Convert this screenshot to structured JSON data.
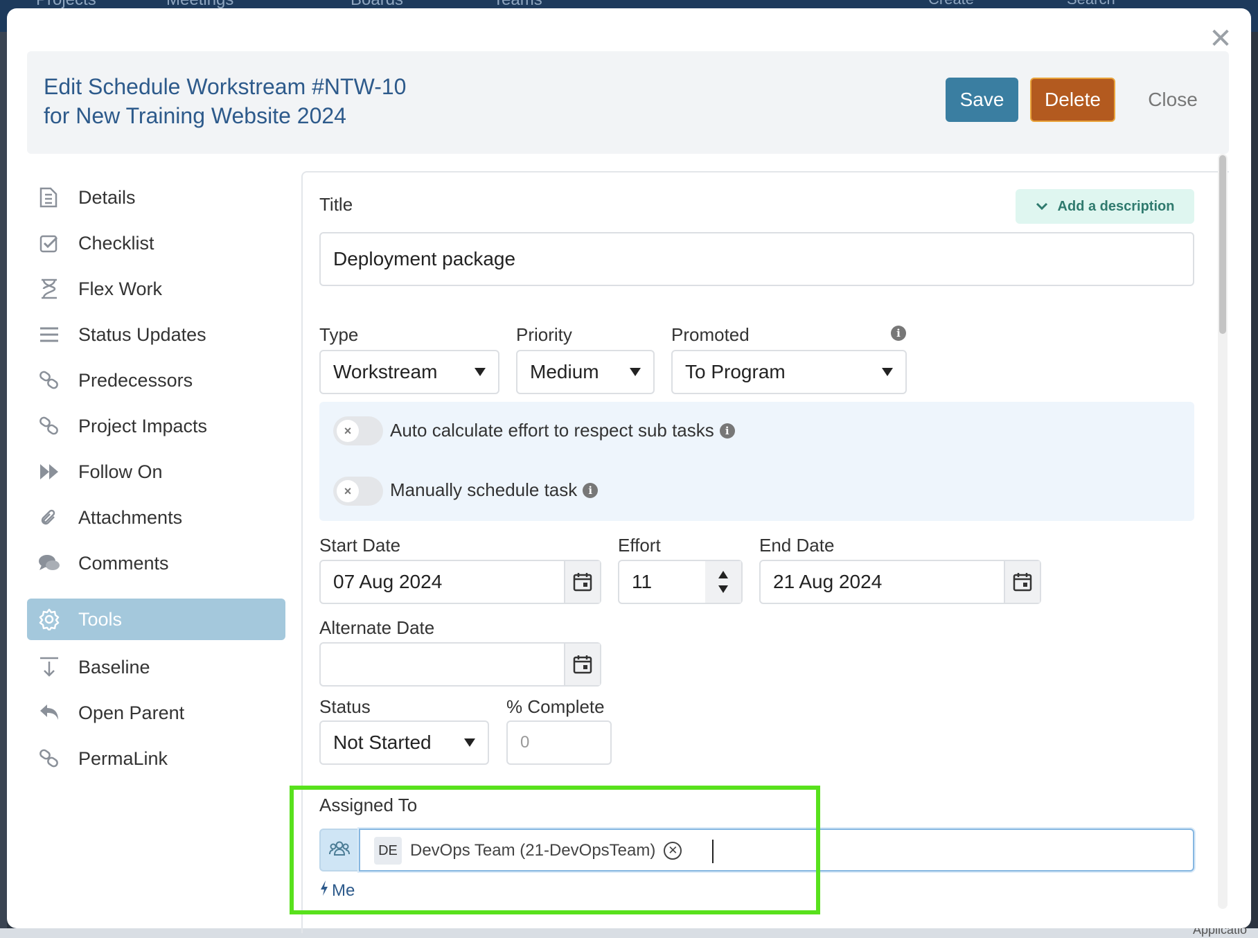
{
  "background": {
    "nav": [
      "Projects",
      "Meetings",
      "Boards",
      "Teams"
    ],
    "create_label": "Create",
    "search_label": "Search",
    "bottom_right_text": "Applicatio"
  },
  "header": {
    "title_line1": "Edit Schedule Workstream #NTW-10",
    "title_line2": "for New Training Website 2024",
    "save_label": "Save",
    "delete_label": "Delete",
    "close_label": "Close"
  },
  "sidebar": {
    "items": [
      {
        "label": "Details",
        "icon": "details-icon"
      },
      {
        "label": "Checklist",
        "icon": "checklist-icon"
      },
      {
        "label": "Flex Work",
        "icon": "hourglass-icon"
      },
      {
        "label": "Status Updates",
        "icon": "list-icon"
      },
      {
        "label": "Predecessors",
        "icon": "link-icon"
      },
      {
        "label": "Project Impacts",
        "icon": "link-icon"
      },
      {
        "label": "Follow On",
        "icon": "fast-forward-icon"
      },
      {
        "label": "Attachments",
        "icon": "paperclip-icon"
      },
      {
        "label": "Comments",
        "icon": "comments-icon"
      },
      {
        "label": "Tools",
        "icon": "gear-icon",
        "active": true
      },
      {
        "label": "Baseline",
        "icon": "download-icon"
      },
      {
        "label": "Open Parent",
        "icon": "reply-icon"
      },
      {
        "label": "PermaLink",
        "icon": "link-icon"
      }
    ]
  },
  "form": {
    "title_label": "Title",
    "add_description_label": "Add a description",
    "title_value": "Deployment package",
    "type_label": "Type",
    "type_value": "Workstream",
    "priority_label": "Priority",
    "priority_value": "Medium",
    "promoted_label": "Promoted",
    "promoted_value": "To Program",
    "auto_calc_label": "Auto calculate effort to respect sub tasks",
    "manual_schedule_label": "Manually schedule task",
    "start_date_label": "Start Date",
    "start_date_value": "07 Aug 2024",
    "effort_label": "Effort",
    "effort_value": "11",
    "end_date_label": "End Date",
    "end_date_value": "21 Aug 2024",
    "alternate_date_label": "Alternate Date",
    "alternate_date_value": "",
    "status_label": "Status",
    "status_value": "Not Started",
    "percent_label": "% Complete",
    "percent_placeholder": "0",
    "assigned_label": "Assigned To",
    "assignee_initials": "DE",
    "assignee_name": "DevOps Team (21-DevOpsTeam)",
    "me_label": "Me"
  },
  "colors": {
    "primary": "#3a7ea1",
    "danger": "#b35a1f",
    "highlight": "#58e11c",
    "title_blue": "#2d5a8b"
  }
}
